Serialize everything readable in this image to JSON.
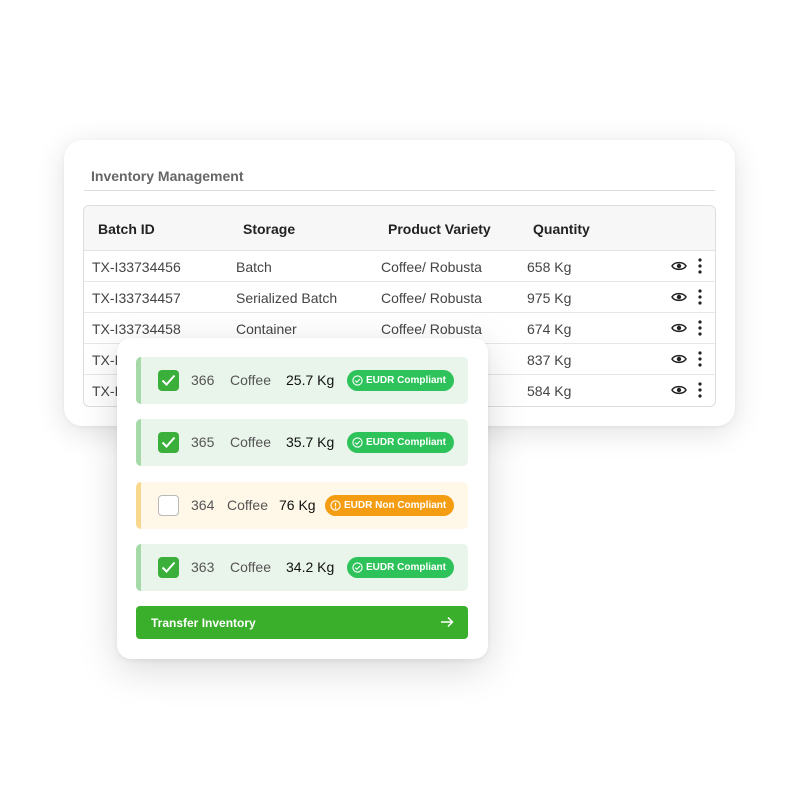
{
  "inventory": {
    "title": "Inventory Management",
    "headers": [
      "Batch ID",
      "Storage",
      "Product Variety",
      "Quantity"
    ],
    "rows": [
      {
        "batch_id": "TX-I33734456",
        "storage": "Batch",
        "variety": "Coffee/ Robusta",
        "quantity": "658 Kg"
      },
      {
        "batch_id": "TX-I33734457",
        "storage": "Serialized Batch",
        "variety": "Coffee/ Robusta",
        "quantity": "975 Kg"
      },
      {
        "batch_id": "TX-I33734458",
        "storage": "Container",
        "variety": "Coffee/ Robusta",
        "quantity": "674 Kg"
      },
      {
        "batch_id": "TX-I",
        "storage": "",
        "variety": "",
        "quantity": "837 Kg"
      },
      {
        "batch_id": "TX-I",
        "storage": "",
        "variety": "",
        "quantity": "584 Kg"
      }
    ],
    "row_icons": [
      "eye-icon",
      "more-vertical-icon"
    ]
  },
  "transfer_panel": {
    "items": [
      {
        "id": "366",
        "product": "Coffee",
        "weight": "25.7 Kg",
        "badge": "EUDR Compliant",
        "checked": true,
        "status": "compliant"
      },
      {
        "id": "365",
        "product": "Coffee",
        "weight": "35.7 Kg",
        "badge": "EUDR Compliant",
        "checked": true,
        "status": "compliant"
      },
      {
        "id": "364",
        "product": "Coffee",
        "weight": "76 Kg",
        "badge": "EUDR Non Compliant",
        "checked": false,
        "status": "non-compliant"
      },
      {
        "id": "363",
        "product": "Coffee",
        "weight": "34.2 Kg",
        "badge": "EUDR Compliant",
        "checked": true,
        "status": "compliant"
      }
    ],
    "button_label": "Transfer Inventory",
    "button_icon": "arrow-right-icon"
  },
  "colors": {
    "accent_green": "#3aaf2b",
    "compliant_badge": "#2ec25a",
    "noncompliant_badge": "#f59d12",
    "compliant_row_bg": "#e9f5ea",
    "noncompliant_row_bg": "#fff8e8"
  }
}
